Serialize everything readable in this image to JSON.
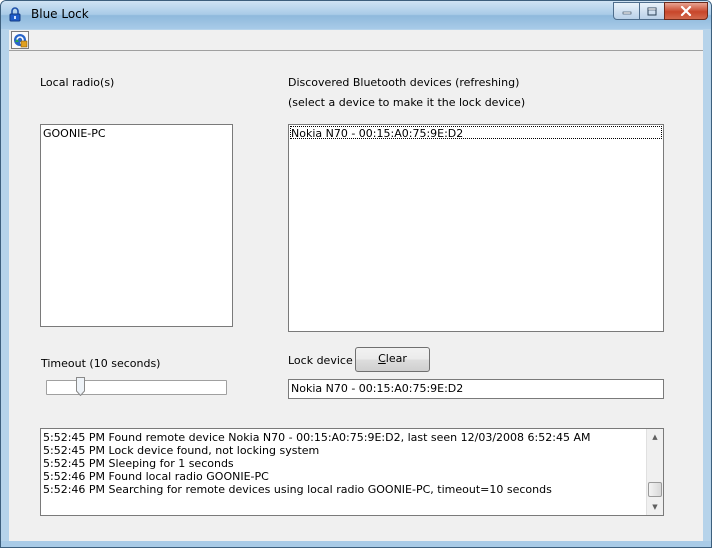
{
  "window": {
    "title": "Blue Lock"
  },
  "icons": {
    "app": "bluetooth-lock-icon",
    "toolbar": "refresh-icon",
    "minimize": "minimize-icon",
    "maximize": "maximize-icon",
    "close": "close-icon"
  },
  "labels": {
    "local_radios": "Local radio(s)",
    "discovered_line1": "Discovered Bluetooth devices (refreshing)",
    "discovered_line2": "(select a device to make it the lock device)",
    "timeout": "Timeout (10 seconds)",
    "lock_device": "Lock device"
  },
  "local_radios": [
    "GOONIE-PC"
  ],
  "discovered_devices": [
    "Nokia N70 - 00:15:A0:75:9E:D2"
  ],
  "timeout": {
    "seconds": 10,
    "slider_fraction": 0.19
  },
  "lock_device": {
    "value": "Nokia N70 - 00:15:A0:75:9E:D2",
    "clear_mnemonic": "C",
    "clear_rest": "lear"
  },
  "log": [
    "5:52:45 PM Found remote device Nokia N70 - 00:15:A0:75:9E:D2, last seen 12/03/2008 6:52:45 AM",
    "5:52:45 PM Lock device found, not locking system",
    "5:52:45 PM Sleeping for 1 seconds",
    "5:52:46 PM Found local radio GOONIE-PC",
    "5:52:46 PM Searching for remote devices using local radio GOONIE-PC, timeout=10 seconds"
  ],
  "log_scroll_fraction": 1.0,
  "colors": {
    "titlebar": "#a9cbe7",
    "client_bg": "#f0f0f0",
    "close_button": "#c8462a"
  }
}
